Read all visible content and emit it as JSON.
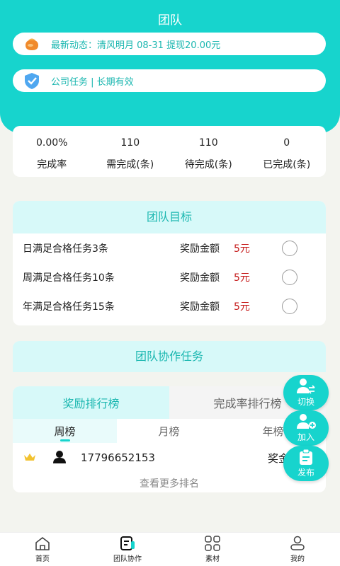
{
  "header": {
    "title": "团队",
    "news": "最新动态：清风明月 08-31 提现20.00元",
    "task": "公司任务 | 长期有效"
  },
  "stats": [
    {
      "value": "0.00%",
      "label": "完成率"
    },
    {
      "value": "110",
      "label": "需完成(条)"
    },
    {
      "value": "110",
      "label": "待完成(条)"
    },
    {
      "value": "0",
      "label": "已完成(条)"
    }
  ],
  "goals": {
    "title": "团队目标",
    "reward_label": "奖励金额",
    "items": [
      {
        "text": "日满足合格任务3条",
        "amount": "5元"
      },
      {
        "text": "周满足合格任务10条",
        "amount": "5元"
      },
      {
        "text": "年满足合格任务15条",
        "amount": "5元"
      }
    ]
  },
  "coop": {
    "title": "团队协作任务"
  },
  "ranking": {
    "tabs": [
      "奖励排行榜",
      "完成率排行榜"
    ],
    "subtabs": [
      "周榜",
      "月榜",
      "年榜"
    ],
    "rows": [
      {
        "phone": "17796652153",
        "reward": "奖金"
      }
    ],
    "more": "查看更多排名"
  },
  "fabs": [
    "切换",
    "加入",
    "发布"
  ],
  "tabbar": [
    "首页",
    "团队协作",
    "素材",
    "我的"
  ],
  "colors": {
    "accent": "#17d4cd",
    "reward": "#c61b1b"
  }
}
